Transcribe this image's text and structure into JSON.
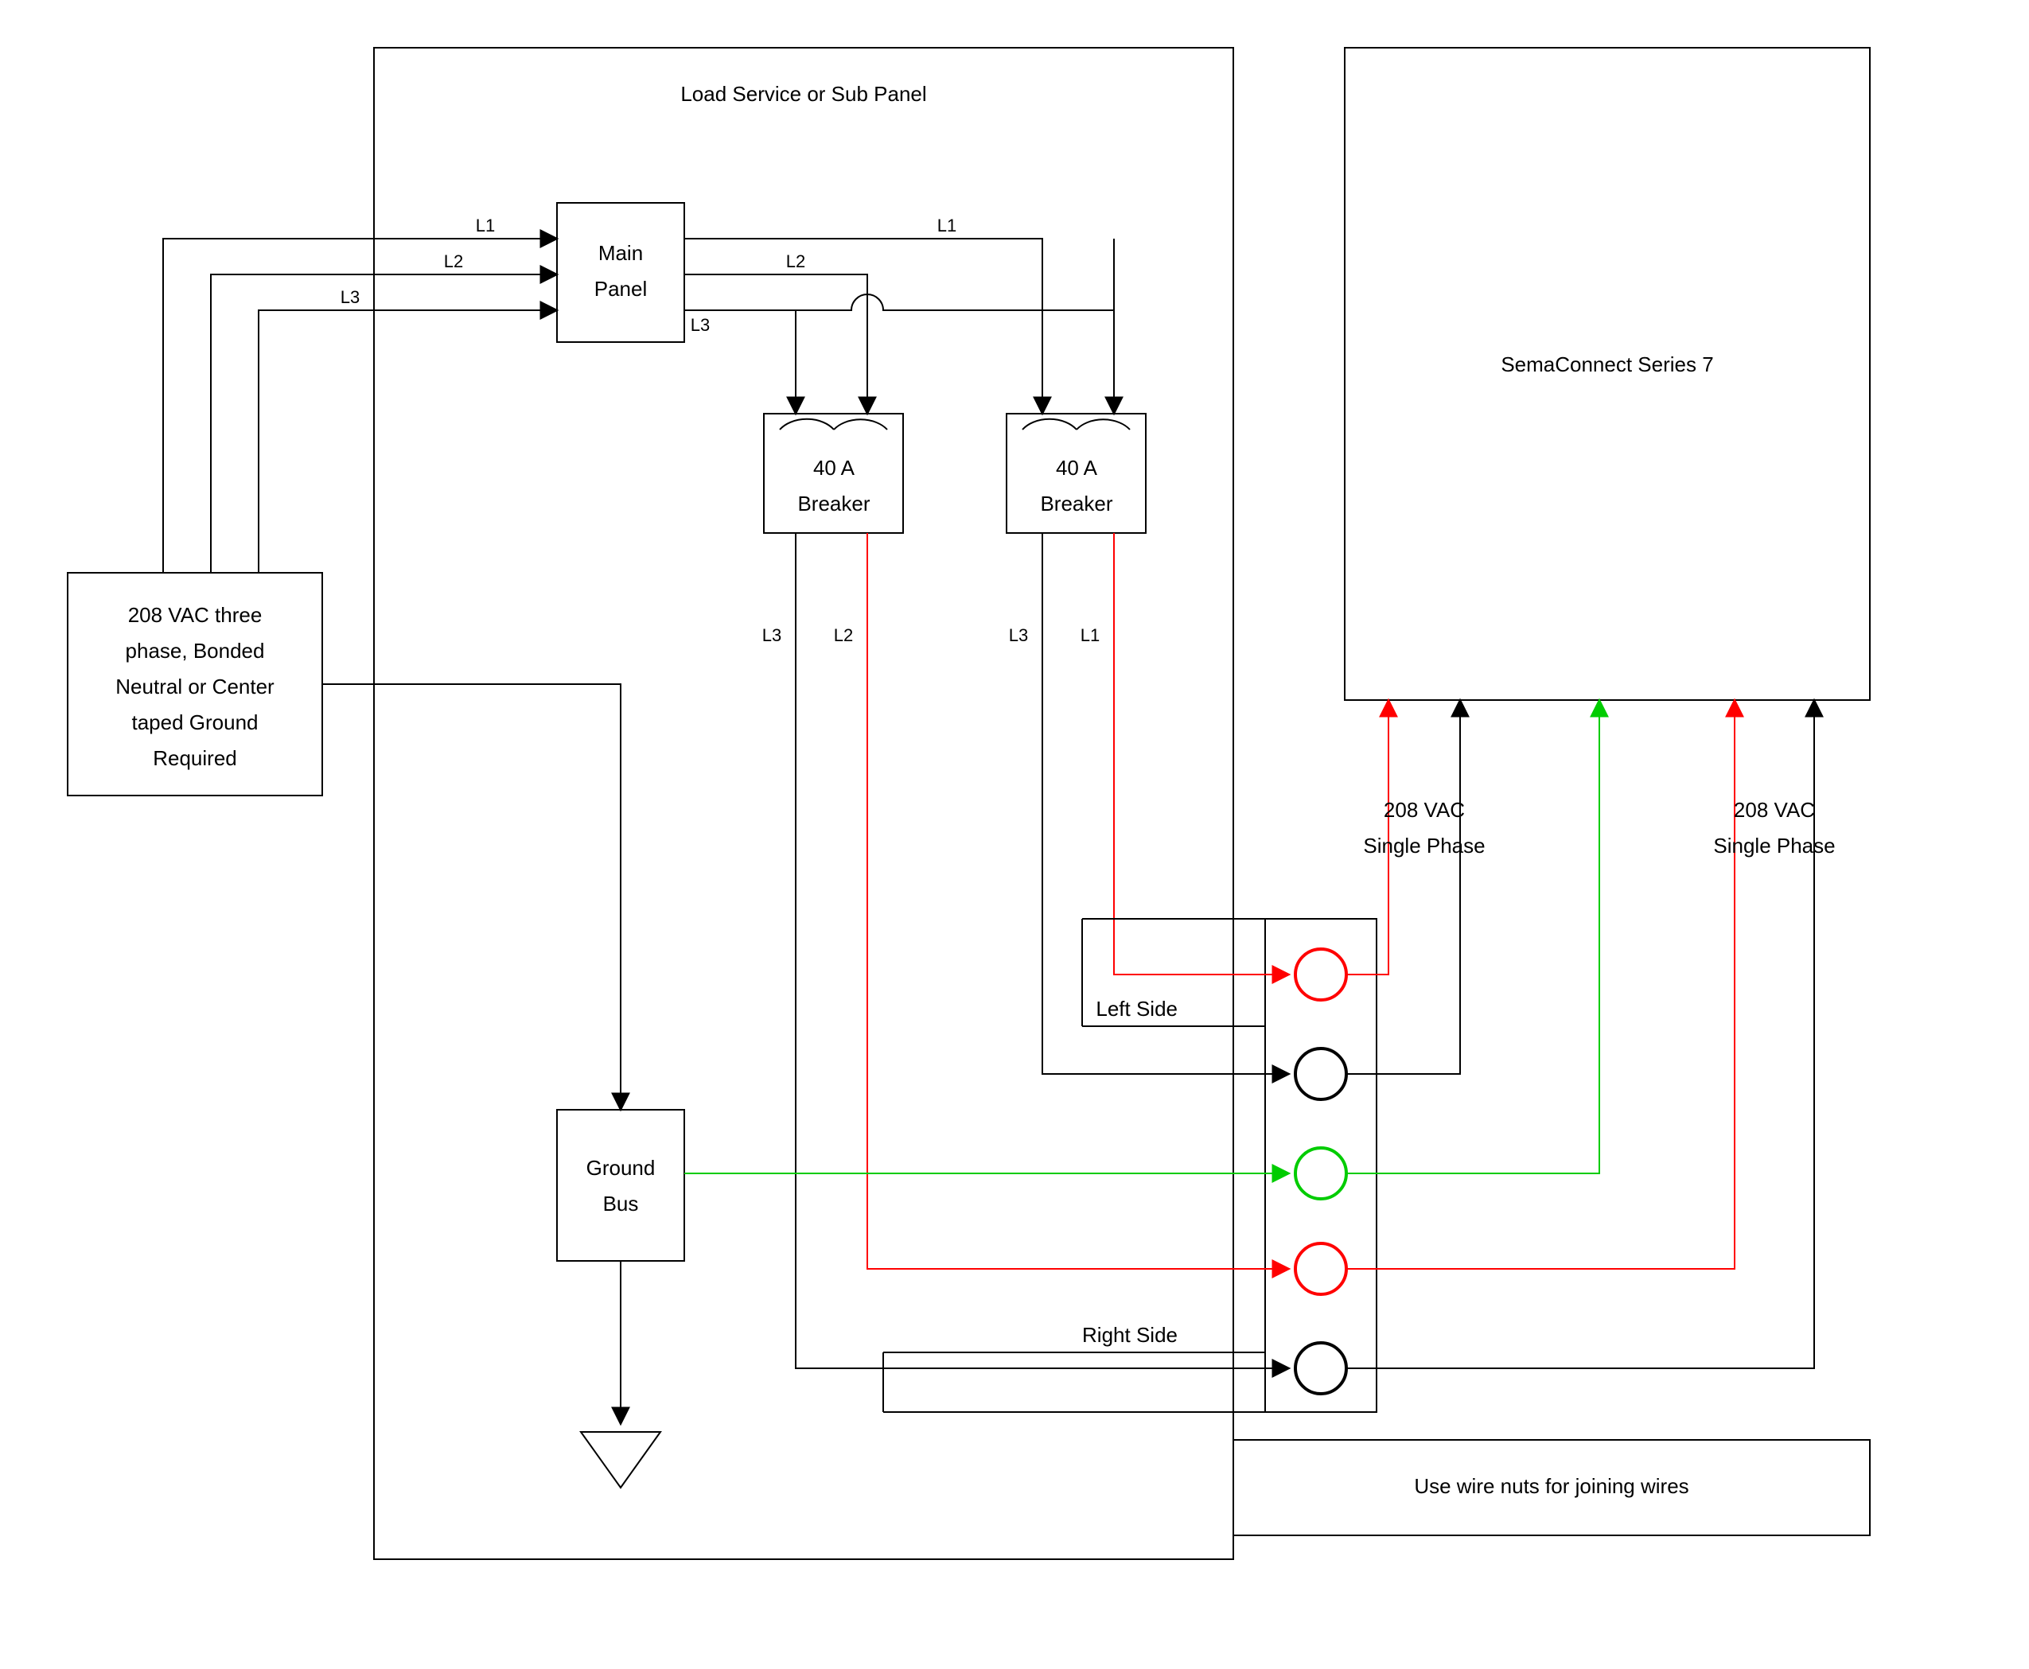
{
  "diagram": {
    "source_box": {
      "line1": "208 VAC three",
      "line2": "phase, Bonded",
      "line3": "Neutral or Center",
      "line4": "taped Ground",
      "line5": "Required"
    },
    "panel_title": "Load Service or Sub Panel",
    "main_panel": {
      "line1": "Main",
      "line2": "Panel"
    },
    "breaker1": {
      "line1": "40 A",
      "line2": "Breaker"
    },
    "breaker2": {
      "line1": "40 A",
      "line2": "Breaker"
    },
    "ground_bus": {
      "line1": "Ground",
      "line2": "Bus"
    },
    "device": "SemaConnect Series 7",
    "left_side": "Left Side",
    "right_side": "Right Side",
    "wire_nuts": "Use wire nuts for joining wires",
    "phase_label1": {
      "line1": "208 VAC",
      "line2": "Single Phase"
    },
    "phase_label2": {
      "line1": "208 VAC",
      "line2": "Single Phase"
    },
    "wires": {
      "L1": "L1",
      "L2": "L2",
      "L3": "L3"
    }
  }
}
